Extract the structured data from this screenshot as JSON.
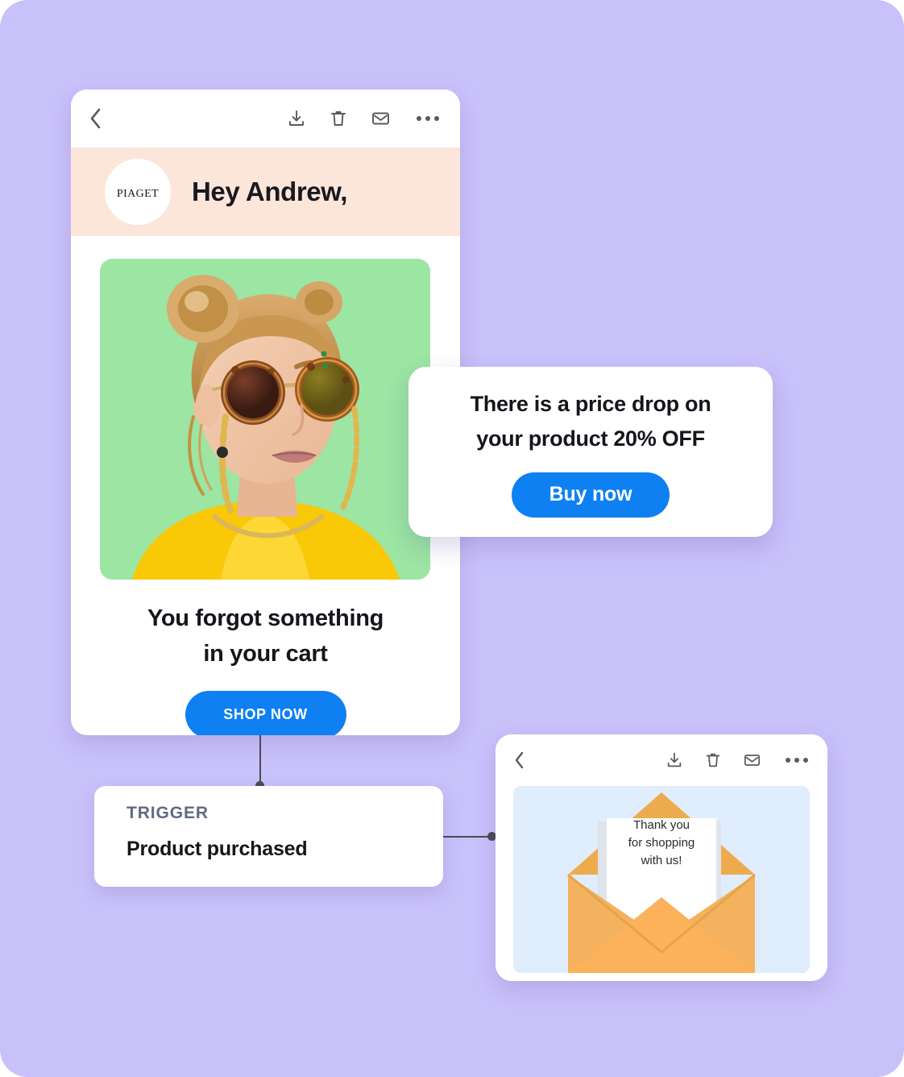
{
  "canvas": {
    "background_color": "#c9c1fa"
  },
  "accent_colors": {
    "primary_blue": "#0e80f2",
    "peach_band": "#fce6da",
    "trigger_label": "#5f6a82",
    "illustration_blue": "#e0edfd",
    "envelope_orange": "#f9ad52",
    "envelope_orange_dark": "#eeab4e",
    "photo_green": "#9ce5a3",
    "connector": "#4a4a55"
  },
  "email_main": {
    "toolbar": {
      "back_icon": "chevron-left-icon",
      "download_icon": "download-icon",
      "delete_icon": "trash-icon",
      "mail_icon": "envelope-icon",
      "more_icon": "more-dots-icon"
    },
    "brand": {
      "logo_text": "PIAGET",
      "greeting": "Hey Andrew,"
    },
    "hero": {
      "alt": "woman wearing round tortoiseshell sunglasses with gold chain on green background"
    },
    "headline_line1": "You forgot something",
    "headline_line2": "in your cart",
    "cta_label": "SHOP NOW"
  },
  "price_drop": {
    "line1": "There is a price drop on",
    "line2": "your product 20% OFF",
    "cta_label": "Buy now"
  },
  "trigger": {
    "label": "TRIGGER",
    "value": "Product purchased"
  },
  "email_thanks": {
    "toolbar": {
      "back_icon": "chevron-left-icon",
      "download_icon": "download-icon",
      "delete_icon": "trash-icon",
      "mail_icon": "envelope-icon",
      "more_icon": "more-dots-icon"
    },
    "note_line1": "Thank you",
    "note_line2": "for shopping",
    "note_line3": "with us!"
  }
}
